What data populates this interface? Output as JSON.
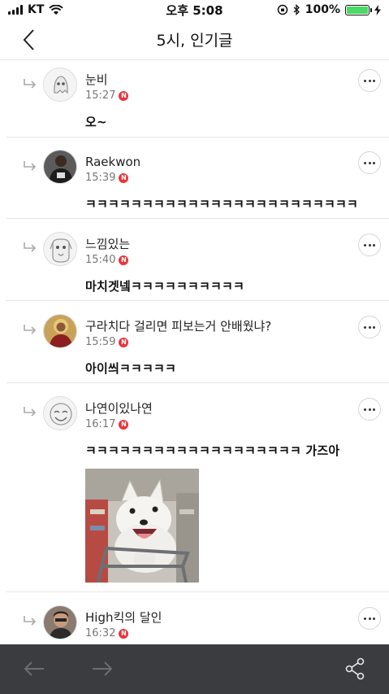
{
  "status_bar": {
    "carrier": "KT",
    "time": "오후 5:08",
    "battery": "100%",
    "battery_level": 1.0
  },
  "header": {
    "title": "5시, 인기글"
  },
  "comments": [
    {
      "author": "눈비",
      "time": "15:27",
      "badge": "N",
      "text": "오~"
    },
    {
      "author": "Raekwon",
      "time": "15:39",
      "badge": "N",
      "text": "ㅋㅋㅋㅋㅋㅋㅋㅋㅋㅋㅋㅋㅋㅋㅋㅋㅋㅋㅋㅋㅋㅋㅋㅋ"
    },
    {
      "author": "느낌있는",
      "time": "15:40",
      "badge": "N",
      "text": "마치겟넼ㅋㅋㅋㅋㅋㅋㅋㅋㅋㅋ"
    },
    {
      "author": "구라치다 걸리면 피보는거 안배웠냐?",
      "time": "15:59",
      "badge": "N",
      "text": "아이씌ㅋㅋㅋㅋㅋ"
    },
    {
      "author": "나연이있나연",
      "time": "16:17",
      "badge": "N",
      "text": "ㅋㅋㅋㅋㅋㅋㅋㅋㅋㅋㅋㅋㅋㅋㅋㅋㅋㅋㅋ 가즈아",
      "has_image": true
    },
    {
      "author": "High킥의 달인",
      "time": "16:32",
      "badge": "N",
      "text": ""
    }
  ],
  "icons": {
    "back": "chevron-left-icon",
    "more": "more-dots-icon",
    "reply": "reply-arrow-icon",
    "prev": "arrow-left-icon",
    "next": "arrow-right-icon",
    "share": "share-icon"
  },
  "colors": {
    "badge": "#e8353c",
    "toolbar": "#3a3c3f",
    "battery": "#4cd964"
  }
}
